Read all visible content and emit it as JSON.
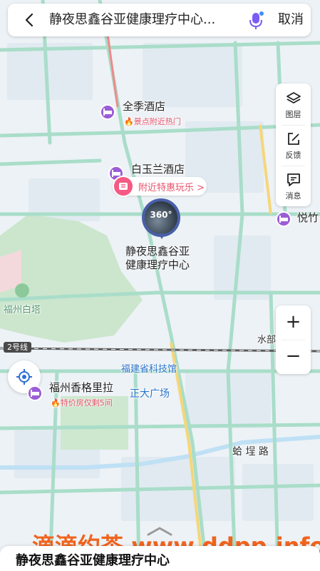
{
  "search": {
    "query": "静夜思鑫谷亚健康理疗中心...",
    "cancel_label": "取消"
  },
  "tools": [
    {
      "label": "图层",
      "icon": "layers-icon"
    },
    {
      "label": "反馈",
      "icon": "feedback-edit-icon"
    },
    {
      "label": "消息",
      "icon": "message-icon"
    }
  ],
  "zoom": {
    "in_label": "+",
    "out_label": "−"
  },
  "map": {
    "main_poi": {
      "badge": "360°",
      "name_line1": "静夜思鑫谷亚",
      "name_line2": "健康理疗中心"
    },
    "pois": [
      {
        "name": "全季酒店",
        "tag": "景点附近热门"
      },
      {
        "name": "白玉兰酒店"
      },
      {
        "name": "悦竹"
      },
      {
        "name": "福州香格里拉",
        "tag": "特价房仅剩5间"
      }
    ],
    "promo": {
      "text": "附近特惠玩乐 >"
    },
    "places": {
      "fuzhou_baita": "福州白塔",
      "science_museum": "福建省科技馆",
      "zhengda_plaza": "正大广场",
      "shuibu": "水部",
      "road": "蛤 埕 路"
    },
    "metro_line": "2号线",
    "colors": {
      "road": "#a8dcc8",
      "block": "#e3ecf2",
      "green": "#cde8cf",
      "hotel": "#9b5dd6",
      "promo": "#f45a83",
      "accent_label": "#2b73c9"
    }
  },
  "watermark": "滴滴约茶 www.ddpp.info",
  "sheet": {
    "title": "静夜思鑫谷亚健康理疗中心"
  }
}
